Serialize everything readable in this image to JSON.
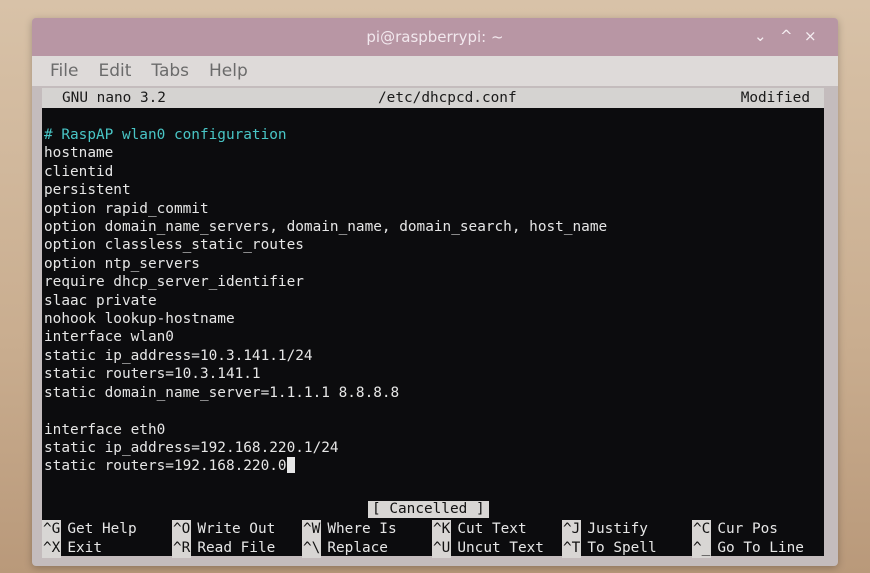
{
  "window": {
    "title": "pi@raspberrypi: ~",
    "controls": {
      "minimize": "⌄",
      "maximize": "^",
      "close": "×"
    }
  },
  "menu": [
    "File",
    "Edit",
    "Tabs",
    "Help"
  ],
  "nano": {
    "version": "GNU nano 3.2",
    "filename": "/etc/dhcpcd.conf",
    "state": "Modified"
  },
  "file_lines": [
    "# RaspAP wlan0 configuration",
    "hostname",
    "clientid",
    "persistent",
    "option rapid_commit",
    "option domain_name_servers, domain_name, domain_search, host_name",
    "option classless_static_routes",
    "option ntp_servers",
    "require dhcp_server_identifier",
    "slaac private",
    "nohook lookup-hostname",
    "interface wlan0",
    "static ip_address=10.3.141.1/24",
    "static routers=10.3.141.1",
    "static domain_name_server=1.1.1.1 8.8.8.8",
    "",
    "interface eth0",
    "static ip_address=192.168.220.1/24",
    "static routers=192.168.220.0"
  ],
  "status_message": "[ Cancelled ]",
  "shortcuts": [
    [
      {
        "key": "^G",
        "label": "Get Help"
      },
      {
        "key": "^O",
        "label": "Write Out"
      },
      {
        "key": "^W",
        "label": "Where Is"
      },
      {
        "key": "^K",
        "label": "Cut Text"
      },
      {
        "key": "^J",
        "label": "Justify"
      },
      {
        "key": "^C",
        "label": "Cur Pos"
      }
    ],
    [
      {
        "key": "^X",
        "label": "Exit"
      },
      {
        "key": "^R",
        "label": "Read File"
      },
      {
        "key": "^\\",
        "label": "Replace"
      },
      {
        "key": "^U",
        "label": "Uncut Text"
      },
      {
        "key": "^T",
        "label": "To Spell"
      },
      {
        "key": "^_",
        "label": "Go To Line"
      }
    ]
  ],
  "colors": {
    "titlebar": "#b896a4",
    "terminal_bg": "#0c0c0e",
    "comment": "#49c6c6",
    "header_bg": "#d5d3d1"
  }
}
